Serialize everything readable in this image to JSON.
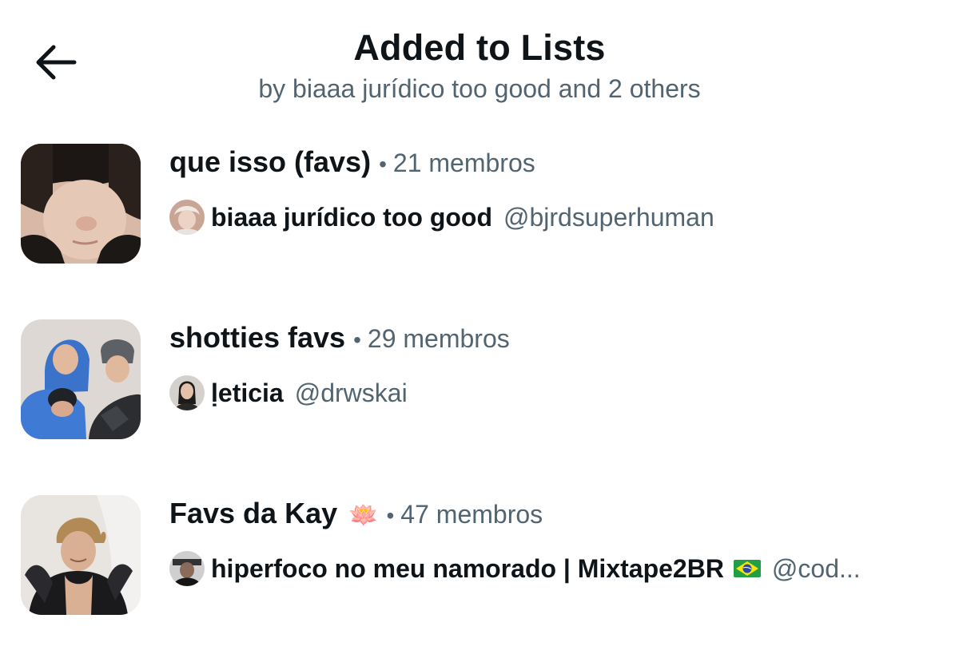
{
  "header": {
    "title": "Added to Lists",
    "subtitle": "by biaaa jurídico too good and 2 others",
    "back_icon": "arrow-left-icon"
  },
  "lists": [
    {
      "name": "que isso (favs)",
      "name_emoji": "",
      "separator": "•",
      "members": "21 membros",
      "owner_name": "biaaa jurídico too good",
      "owner_flag": "",
      "owner_handle": "@bjrdsuperhuman"
    },
    {
      "name": "shotties favs",
      "name_emoji": "",
      "separator": "•",
      "members": "29 membros",
      "owner_name": "ḷeticia",
      "owner_flag": "",
      "owner_handle": "@drwskai"
    },
    {
      "name": "Favs da Kay",
      "name_emoji": "🪷",
      "separator": "•",
      "members": "47 membros",
      "owner_name": "hiperfoco no meu namorado | Mixtape2BR",
      "owner_flag": "brazil-flag-icon",
      "owner_handle": "@cod..."
    }
  ],
  "colors": {
    "primary_text": "#0f1419",
    "secondary_text": "#536471",
    "background": "#ffffff"
  }
}
